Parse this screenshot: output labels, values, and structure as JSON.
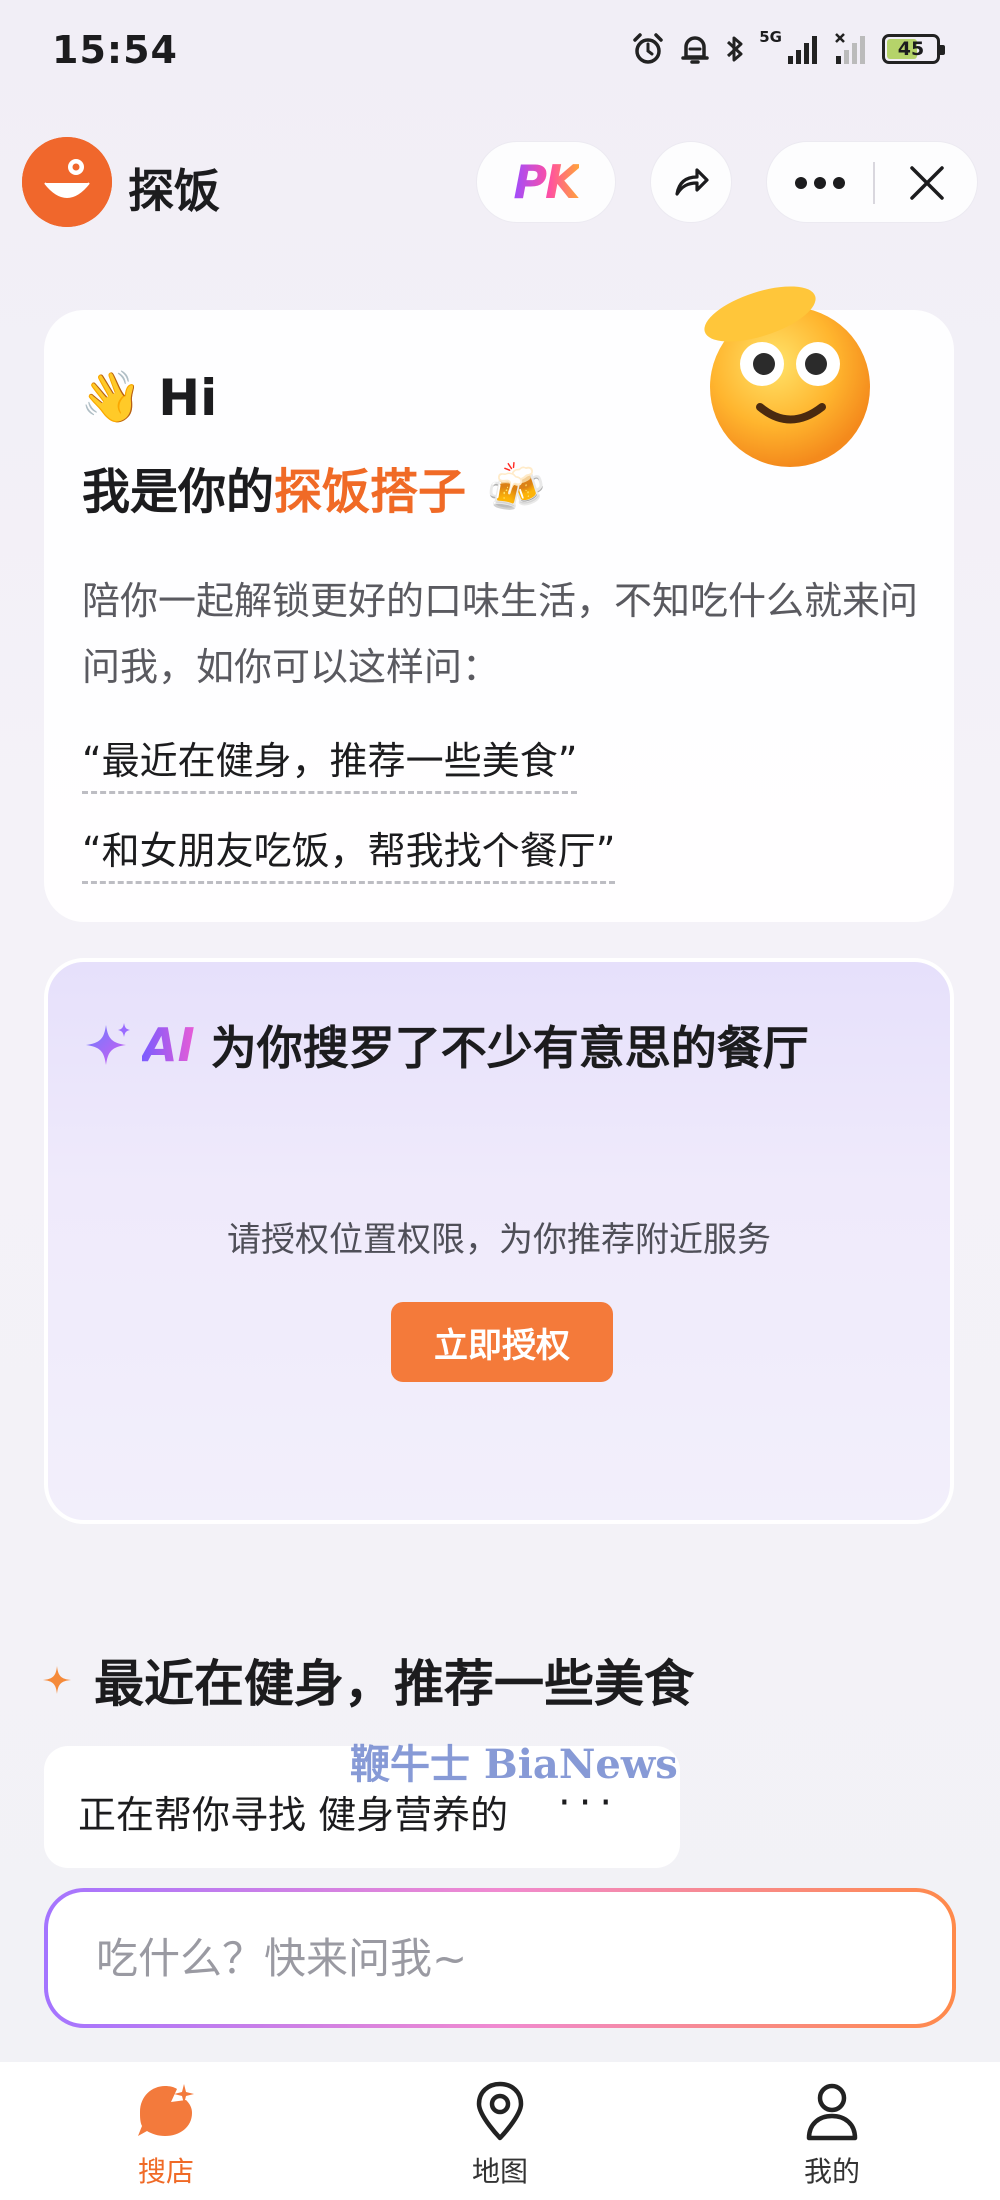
{
  "status_bar": {
    "time": "15:54",
    "network_label": "5G",
    "battery": "45",
    "icons": [
      "alarm-icon",
      "mute-bell-icon",
      "bluetooth-icon",
      "signal-icon",
      "signal-weak-icon",
      "battery-icon"
    ]
  },
  "header": {
    "app_name": "探饭",
    "pk_label": "PK",
    "icons": [
      "logo-icon",
      "share-icon",
      "more-icon",
      "close-icon"
    ]
  },
  "greeting": {
    "wave_emoji": "👋",
    "hi": "Hi",
    "intro_prefix": "我是你的",
    "intro_accent": "探饭搭子",
    "beer_emoji": "🍻",
    "description": "陪你一起解锁更好的口味生活，不知吃什么就来问问我，如你可以这样问：",
    "examples": [
      "“最近在健身，推荐一些美食”",
      "“和女朋友吃饭，帮我找个餐厅”"
    ],
    "accent_color": "#f06a26"
  },
  "ai_card": {
    "ai_label": "AI",
    "title": "为你搜罗了不少有意思的餐厅",
    "auth_prompt": "请授权位置权限，为你推荐附近服务",
    "auth_button": "立即授权",
    "button_color": "#f47a3a"
  },
  "conversation": {
    "query": "最近在健身，推荐一些美食",
    "answer_text": "正在帮你寻找 健身营养的",
    "answer_dots": "···",
    "watermark": "鞭牛士 BiaNews"
  },
  "input": {
    "placeholder": "吃什么？快来问我~"
  },
  "bottom_nav": {
    "items": [
      {
        "label": "搜店",
        "icon": "shop-search-icon",
        "active": true
      },
      {
        "label": "地图",
        "icon": "map-pin-icon",
        "active": false
      },
      {
        "label": "我的",
        "icon": "person-icon",
        "active": false
      }
    ]
  }
}
